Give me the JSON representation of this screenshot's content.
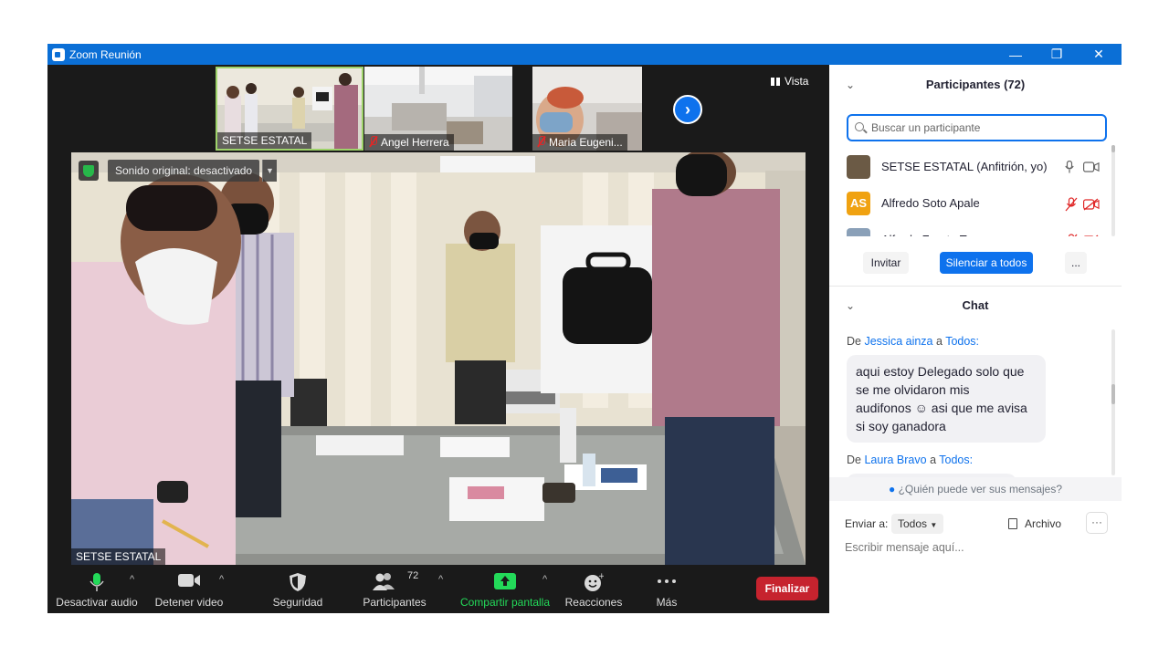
{
  "window": {
    "title": "Zoom Reunión",
    "controls": {
      "minimize": "—",
      "restore": "❐",
      "close": "✕"
    }
  },
  "thumbnails": [
    {
      "name": "SETSE ESTATAL",
      "muted": false,
      "active": true
    },
    {
      "name": "Angel Herrera",
      "muted": true,
      "active": false
    },
    {
      "name": "Maria Eugeni...",
      "muted": true,
      "active": false
    }
  ],
  "view_button": "Vista",
  "main_video": {
    "original_sound": "Sonido original: desactivado",
    "speaker_name": "SETSE ESTATAL"
  },
  "toolbar": {
    "audio": "Desactivar audio",
    "video": "Detener video",
    "security": "Seguridad",
    "participants": "Participantes",
    "participants_count": "72",
    "share": "Compartir pantalla",
    "reactions": "Reacciones",
    "more": "Más",
    "end": "Finalizar"
  },
  "participants_panel": {
    "title": "Participantes (72)",
    "search_placeholder": "Buscar un participante",
    "list": [
      {
        "name": "SETSE ESTATAL (Anfitrión, yo)",
        "initials": "",
        "avatar_color": "#6b5a45",
        "mic_muted": false,
        "cam_off": false
      },
      {
        "name": "Alfredo Soto Apale",
        "initials": "AS",
        "avatar_color": "#f0a211",
        "mic_muted": true,
        "cam_off": true
      },
      {
        "name": "Alfredo Zarate Tr...",
        "initials": "",
        "avatar_color": "#8aa0b8",
        "mic_muted": true,
        "cam_off": true
      }
    ],
    "invite": "Invitar",
    "mute_all": "Silenciar a todos",
    "more": "..."
  },
  "chat_panel": {
    "title": "Chat",
    "messages": [
      {
        "from_prefix": "De",
        "sender": "Jessica ainza",
        "to_word": "a",
        "recipient": "Todos:",
        "lines": [
          "aqui estoy Delegado solo que",
          "se me olvidaron mis",
          "audifonos ☺ asi que me avisa",
          "si soy ganadora"
        ]
      },
      {
        "from_prefix": "De",
        "sender": "Laura Bravo",
        "to_word": "a",
        "recipient": "Todos:",
        "lines": []
      }
    ],
    "who_can_see": "¿Quién puede ver sus mensajes?",
    "send_to_label": "Enviar a:",
    "send_to_value": "Todos",
    "file_label": "Archivo",
    "more": "···",
    "input_placeholder": "Escribir mensaje aquí..."
  },
  "colors": {
    "accent": "#0e72ed",
    "title_bar": "#0b6fd6",
    "end_button": "#c6232e",
    "share_green": "#23d959",
    "muted_red": "#e02828"
  }
}
